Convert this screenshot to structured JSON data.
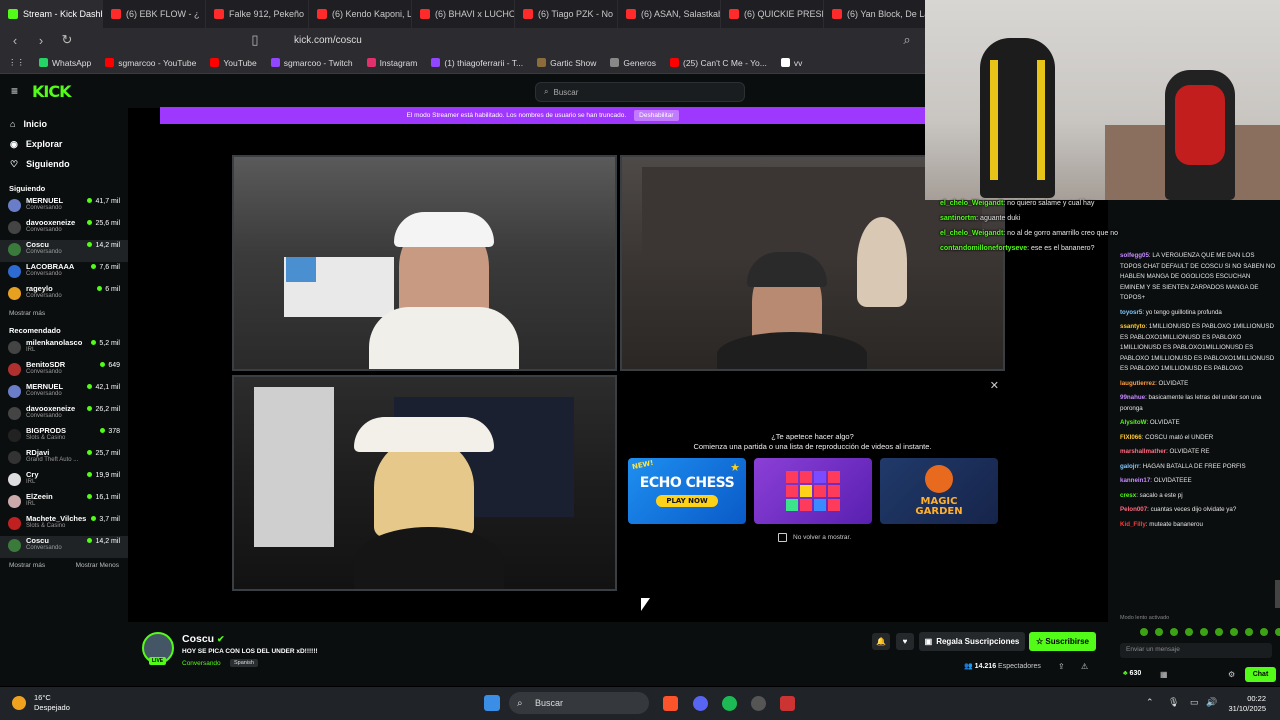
{
  "tabs": [
    {
      "label": "Stream - Kick Dashb",
      "color": "#53fc18"
    },
    {
      "label": "(6) EBK FLOW - ¿",
      "color": "#ff2a2a"
    },
    {
      "label": "Falke 912, Pekeño",
      "color": "#ff2a2a"
    },
    {
      "label": "(6) Kendo Kaponi, L",
      "color": "#ff2a2a"
    },
    {
      "label": "(6) BHAVI x LUCHO",
      "color": "#ff2a2a"
    },
    {
      "label": "(6) Tiago PZK - No",
      "color": "#ff2a2a"
    },
    {
      "label": "(6) ASAN, Salastkab",
      "color": "#ff2a2a"
    },
    {
      "label": "(6) QUICKIE PRESH",
      "color": "#ff2a2a"
    },
    {
      "label": "(6) Yan Block, De La",
      "color": "#ff2a2a"
    }
  ],
  "address": {
    "url": "kick.com/coscu"
  },
  "bookmarks": [
    {
      "label": "WhatsApp",
      "color": "#25d366"
    },
    {
      "label": "sgmarcoo - YouTube",
      "color": "#ff0000"
    },
    {
      "label": "YouTube",
      "color": "#ff0000"
    },
    {
      "label": "sgmarcoo - Twitch",
      "color": "#9146ff"
    },
    {
      "label": "Instagram",
      "color": "#e1306c"
    },
    {
      "label": "(1) thiagoferrarii - T...",
      "color": "#9146ff"
    },
    {
      "label": "Gartic Show",
      "color": "#8a6d3b"
    },
    {
      "label": "Generos",
      "color": "#888888"
    },
    {
      "label": "(25) Can't C Me - Yo...",
      "color": "#ff0000"
    },
    {
      "label": "vv",
      "color": "#ffffff"
    }
  ],
  "header": {
    "logo": "KICK",
    "search_placeholder": "Buscar"
  },
  "sidebar": {
    "nav": [
      {
        "label": "Inicio",
        "icon": "⌂"
      },
      {
        "label": "Explorar",
        "icon": "◉"
      },
      {
        "label": "Siguiendo",
        "icon": "♡"
      }
    ],
    "following_title": "Siguiendo",
    "following": [
      {
        "name": "MERNUEL",
        "cat": "Conversando",
        "viewers": "41,7 mil",
        "color": "#6a7dc9"
      },
      {
        "name": "davooxeneize",
        "cat": "Conversando",
        "viewers": "25,6 mil",
        "color": "#444"
      },
      {
        "name": "Coscu",
        "cat": "Conversando",
        "viewers": "14,2 mil",
        "color": "#3a7a3a",
        "hl": true
      },
      {
        "name": "LACOBRAAA",
        "cat": "Conversando",
        "viewers": "7,6 mil",
        "color": "#2d6ad1"
      },
      {
        "name": "rageylo",
        "cat": "Conversando",
        "viewers": "6 mil",
        "color": "#e8a020"
      }
    ],
    "show_more": "Mostrar más",
    "recommended_title": "Recomendado",
    "recommended": [
      {
        "name": "milenkanolasco",
        "cat": "IRL",
        "viewers": "5,2 mil",
        "color": "#444"
      },
      {
        "name": "BenitoSDR",
        "cat": "Conversando",
        "viewers": "649",
        "color": "#b03030"
      },
      {
        "name": "MERNUEL",
        "cat": "Conversando",
        "viewers": "42,1 mil",
        "color": "#6a7dc9"
      },
      {
        "name": "davooxeneize",
        "cat": "Conversando",
        "viewers": "26,2 mil",
        "color": "#444"
      },
      {
        "name": "BIGPRODS",
        "cat": "Slots & Casino",
        "viewers": "378",
        "color": "#222"
      },
      {
        "name": "RDjavi",
        "cat": "Grand Theft Auto ...",
        "viewers": "25,7 mil",
        "color": "#333"
      },
      {
        "name": "Cry",
        "cat": "IRL",
        "viewers": "19,9 mil",
        "color": "#ddd"
      },
      {
        "name": "ElZeein",
        "cat": "IRL",
        "viewers": "16,1 mil",
        "color": "#caa"
      },
      {
        "name": "Machete_Vilches",
        "cat": "Slots & Casino",
        "viewers": "3,7 mil",
        "color": "#c02020"
      },
      {
        "name": "Coscu",
        "cat": "Conversando",
        "viewers": "14,2 mil",
        "color": "#3a7a3a",
        "hl": true
      }
    ],
    "show_more2": "Mostrar más",
    "show_less": "Mostrar Menos"
  },
  "banner": {
    "text": "El modo Streamer está habilitado. Los nombres de usuario se han truncado.",
    "button": "Deshabilitar"
  },
  "promo": {
    "line1": "¿Te apetece hacer algo?",
    "line2": "Comienza una partida o una lista de reproducción de videos al instante.",
    "games": [
      {
        "title": "ECHO CHESS",
        "badge": "NEW!",
        "cta": "PLAY NOW"
      },
      {
        "title": "",
        "badge": "",
        "cta": ""
      },
      {
        "title": "MAGIC GARDEN",
        "badge": "",
        "cta": ""
      }
    ],
    "dont_show": "No volver a mostrar."
  },
  "stream": {
    "name": "Coscu",
    "title": "HOY SE PICA CON LOS DEL UNDER xD!!!!!!",
    "category": "Conversando",
    "language": "Spanish",
    "live": "LIVE",
    "gift": "Regala Suscripciones",
    "subscribe": "Suscribirse",
    "viewers": "14.216",
    "viewers_label": "Espectadores"
  },
  "overlay_chat": [
    {
      "user": "el_chelo_Weigandt",
      "text": ": no quiero salame y cual hay"
    },
    {
      "user": "santinortm",
      "text": ": aguante duki"
    },
    {
      "user": "el_chelo_Weigandt",
      "text": ": no al de gorro amarrillo creo que no"
    },
    {
      "user": "contandomillonefortyseve",
      "text": ": ese es el bananero?"
    }
  ],
  "chat": [
    {
      "user": "solfegg05",
      "text": ": LA VERGUENZA QUE ME DAN LOS TOPOS CHAT DEFAULT DE COSCU SI NO SABEN NO HABLEN MANGA DE OGOLICOS ESCUCHAN EMINEM Y SE SIENTEN ZARPADOS MANGA DE TOPOS+",
      "color": "#c58bff"
    },
    {
      "user": "toyosr5",
      "text": ": yo tengo guillotina profunda",
      "color": "#7ec8ff"
    },
    {
      "user": "ssantyto",
      "text": ": 1MILLIONUSD ES PABLOXO 1MILLIONUSD ES PABLOXO1MILLIONUSD ES PABLOXO 1MILLIONUSD ES PABLOXO1MILLIONUSD ES PABLOXO 1MILLIONUSD ES PABLOXO1MILLIONUSD ES PABLOXO 1MILLIONUSD ES PABLOXO",
      "color": "#ffcc33"
    },
    {
      "user": "laugutierrez",
      "text": ": OLVIDATE",
      "color": "#ff9f43"
    },
    {
      "user": "99nahue",
      "text": ": basicamente las letras del under son una poronga",
      "color": "#c58bff"
    },
    {
      "user": "AlysitoW",
      "text": ": OLVIDATE",
      "color": "#53fc18"
    },
    {
      "user": "FIXI066",
      "text": ": COSCU mató el UNDER",
      "color": "#ffcc33"
    },
    {
      "user": "marshallmather",
      "text": ": OLVIDATE RE",
      "color": "#ff6b81"
    },
    {
      "user": "galojrr",
      "text": ": HAGAN BATALLA DE FREE PORFIS",
      "color": "#7ec8ff"
    },
    {
      "user": "kannein17",
      "text": ": OLVIDATEEE",
      "color": "#c58bff"
    },
    {
      "user": "cresx",
      "text": ": sacalo a este pj",
      "color": "#53fc18"
    },
    {
      "user": "Pelon007",
      "text": ": cuantas veces dijo olvidate ya?",
      "color": "#ff6b81"
    },
    {
      "user": "Kid_Filly",
      "text": ": muteate bananerou",
      "color": "#ff3b3b"
    }
  ],
  "chatbar": {
    "slow_mode": "Modo lento activado",
    "placeholder": "Enviar un mensaje",
    "points": "630",
    "chat_button": "Chat"
  },
  "taskbar": {
    "temp": "16°C",
    "weather": "Despejado",
    "search": "Buscar",
    "time": "00:22",
    "date": "31/10/2025"
  }
}
